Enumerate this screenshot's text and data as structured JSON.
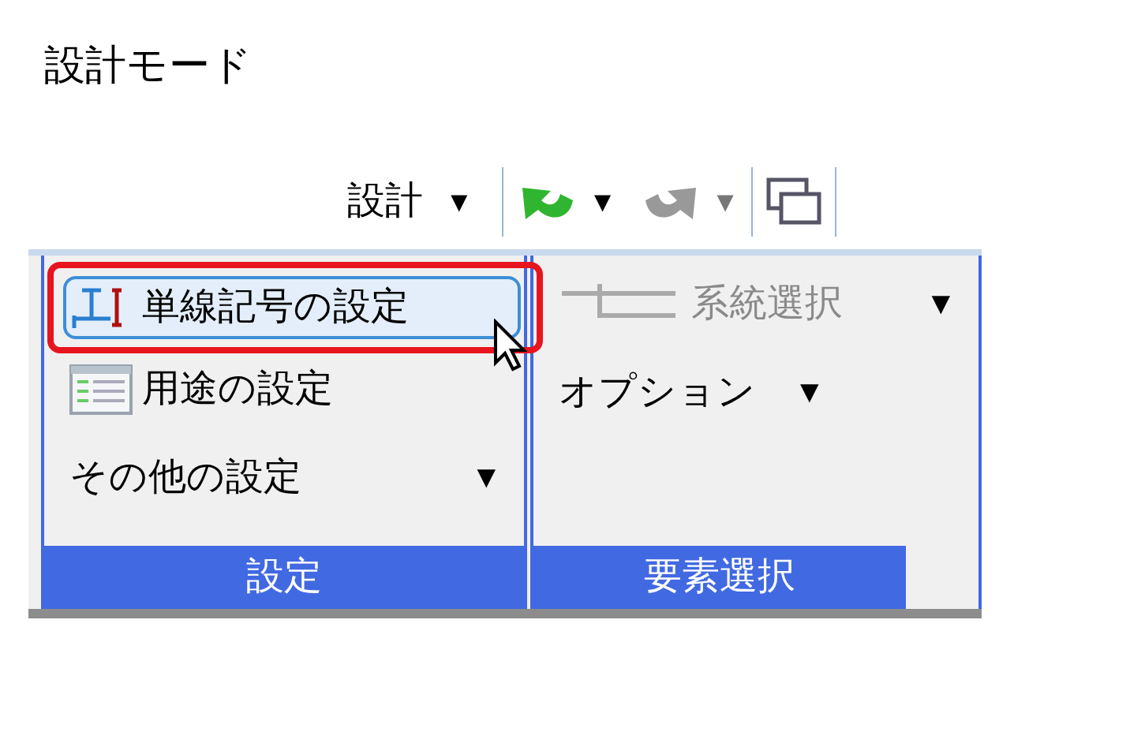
{
  "title": "設計モード",
  "toolbar": {
    "menu": {
      "label": "設計",
      "arrow": "▼"
    },
    "undo": {
      "disabled": false,
      "arrow": "▼"
    },
    "redo": {
      "disabled": true,
      "arrow": "▼"
    }
  },
  "groups": [
    {
      "label": "設定",
      "items": [
        {
          "kind": "button",
          "label": "単線記号の設定",
          "selected": true,
          "disabled": false
        },
        {
          "kind": "button",
          "label": "用途の設定",
          "selected": false,
          "disabled": false
        },
        {
          "kind": "dropdown",
          "label": "その他の設定",
          "arrow": "▼",
          "selected": false,
          "disabled": false
        }
      ]
    },
    {
      "label": "要素選択",
      "items": [
        {
          "kind": "dropdown",
          "label": "系統選択",
          "arrow": "▼",
          "selected": false,
          "disabled": true
        },
        {
          "kind": "dropdown",
          "label": "オプション",
          "arrow": "▼",
          "selected": false,
          "disabled": false
        }
      ]
    }
  ]
}
